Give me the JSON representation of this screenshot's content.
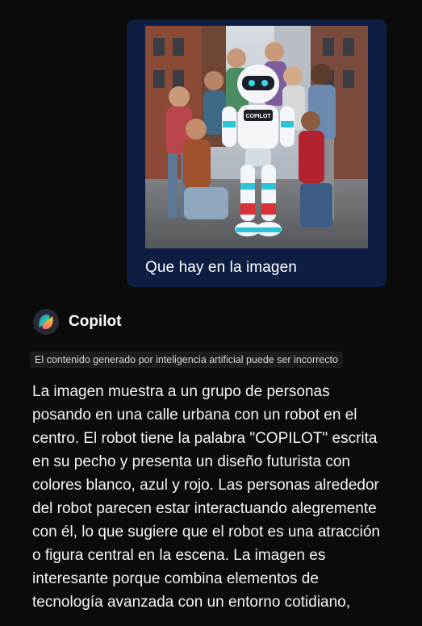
{
  "user_message": {
    "image_alt": "Grupo de personas posando con un robot COPILOT en una calle urbana",
    "robot_chest_label": "COPILOT",
    "text": "Que hay en la imagen"
  },
  "assistant": {
    "name": "Copilot",
    "disclaimer": "El contenido generado por inteligencia artificial puede ser incorrecto",
    "response_lines": [
      "La imagen muestra a un grupo de personas",
      "posando en una calle urbana con un robot en el",
      "centro. El robot tiene la palabra \"COPILOT\" escrita",
      "en su pecho y presenta un diseño futurista con",
      "colores blanco, azul y rojo. Las personas alrededor",
      "del robot parecen estar interactuando alegremente",
      "con él, lo que sugiere que el robot es una atracción",
      "o figura central en la escena. La imagen es",
      "interesante porque combina elementos de",
      "tecnología avanzada con un entorno cotidiano,"
    ]
  },
  "colors": {
    "background": "#0b0b0c",
    "user_bubble": "#0e1e42",
    "disclaimer_bg": "#1c1c1e",
    "text": "#f4f4f4"
  }
}
